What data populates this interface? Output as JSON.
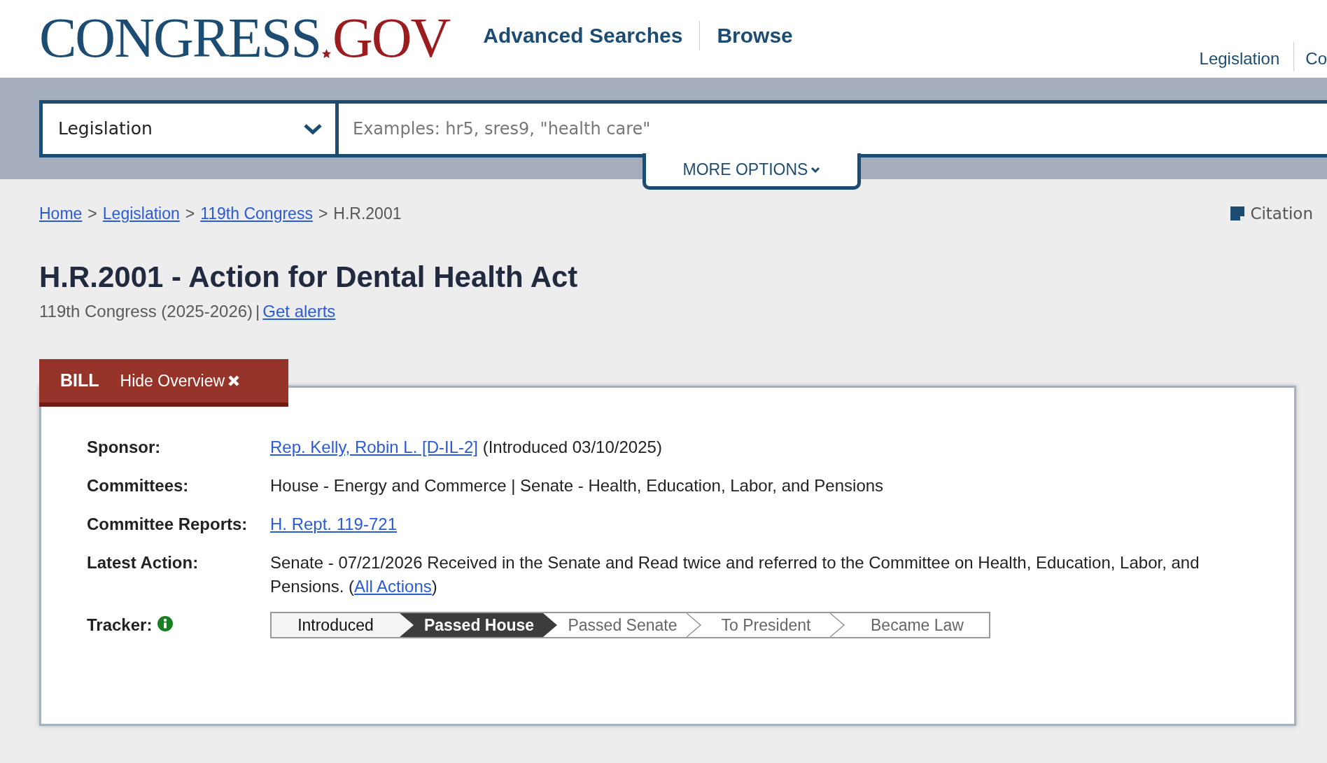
{
  "header": {
    "logo": {
      "primary": "CONGRESS",
      "secondary": "GOV"
    },
    "nav": [
      {
        "label": "Advanced Searches"
      },
      {
        "label": "Browse"
      }
    ],
    "top_links": [
      {
        "label": "Legislation"
      },
      {
        "label": "Co"
      }
    ]
  },
  "search": {
    "scope": "Legislation",
    "placeholder": "Examples: hr5, sres9, \"health care\"",
    "more_options": "MORE OPTIONS"
  },
  "breadcrumb": {
    "separator": ">",
    "items": [
      {
        "label": "Home",
        "link": true
      },
      {
        "label": "Legislation",
        "link": true
      },
      {
        "label": "119th Congress",
        "link": true
      },
      {
        "label": "H.R.2001",
        "link": false
      }
    ]
  },
  "citation": "Citation",
  "title": "H.R.2001 - Action for Dental Health Act",
  "subtitle": {
    "congress": "119th Congress (2025-2026)",
    "separator": "|",
    "alerts": "Get alerts"
  },
  "overview": {
    "tab": "BILL",
    "toggle": "Hide Overview",
    "rows": [
      {
        "label": "Sponsor:",
        "parts": [
          {
            "text": "Rep. Kelly, Robin L. [D-IL-2]",
            "link": true
          },
          {
            "text": " (Introduced 03/10/2025)",
            "link": false
          }
        ]
      },
      {
        "label": "Committees:",
        "parts": [
          {
            "text": "House - Energy and Commerce | Senate - Health, Education, Labor, and Pensions",
            "link": false
          }
        ]
      },
      {
        "label": "Committee Reports:",
        "parts": [
          {
            "text": "H. Rept. 119-721",
            "link": true
          }
        ]
      },
      {
        "label": "Latest Action:",
        "parts": [
          {
            "text": "Senate - 07/21/2026 Received in the Senate and Read twice and referred to the Committee on Health, Education, Labor, and Pensions.  (",
            "link": false
          },
          {
            "text": "All Actions",
            "link": true
          },
          {
            "text": ")",
            "link": false
          }
        ]
      }
    ],
    "tracker": {
      "label": "Tracker:",
      "steps": [
        {
          "label": "Introduced",
          "kind": "past"
        },
        {
          "label": "Passed House",
          "kind": "current"
        },
        {
          "label": "Passed Senate",
          "kind": "future"
        },
        {
          "label": "To President",
          "kind": "future"
        },
        {
          "label": "Became Law",
          "kind": "future"
        }
      ]
    }
  }
}
